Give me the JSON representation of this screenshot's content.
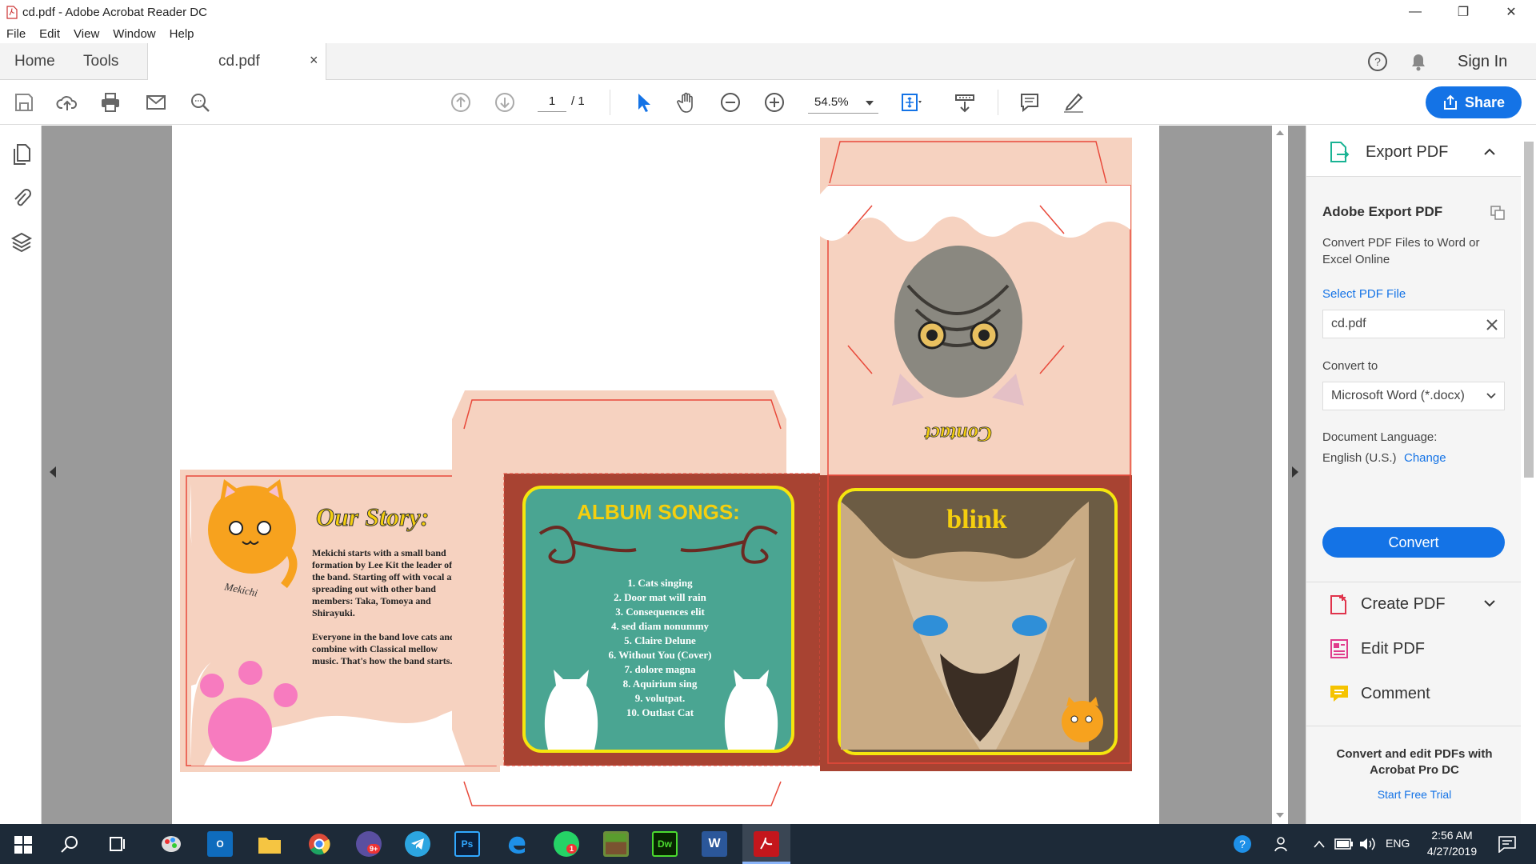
{
  "window": {
    "title": "cd.pdf - Adobe Acrobat Reader DC",
    "minimize_glyph": "—",
    "maximize_glyph": "❐",
    "close_glyph": "✕"
  },
  "menu": [
    "File",
    "Edit",
    "View",
    "Window",
    "Help"
  ],
  "tabs": {
    "home": "Home",
    "tools": "Tools",
    "document": "cd.pdf",
    "close_glyph": "×",
    "sign_in": "Sign In"
  },
  "toolbar": {
    "page_current": "1",
    "page_total": "/ 1",
    "zoom": "54.5%",
    "share": "Share"
  },
  "document": {
    "our_story_title": "Our Story:",
    "story_p1": "Mekichi starts with a small band formation by Lee Kit the leader of the band. Starting off with vocal and spreading out with other band members: Taka, Tomoya and Shirayuki.",
    "story_p2": "Everyone in the band love cats and combine with Classical mellow music. That's how the band starts.",
    "signature": "Mekichi",
    "album_songs_title": "ALBUM SONGS:",
    "songs": [
      "1. Cats singing",
      "2. Door mat will rain",
      "3. Consequences elit",
      "4.      sed diam nonummy",
      "5. Claire Delune",
      "6. Without You (Cover)",
      "7. dolore magna",
      "8. Aquirium sing",
      "9. volutpat.",
      "10. Outlast Cat"
    ],
    "cover_title": "blink",
    "flap_text": "Contact"
  },
  "right_panel": {
    "export_title": "Export PDF",
    "adobe_export": "Adobe Export PDF",
    "description": "Convert PDF Files to Word or Excel Online",
    "select_file": "Select PDF File",
    "file_name": "cd.pdf",
    "convert_to_label": "Convert to",
    "convert_to_value": "Microsoft Word (*.docx)",
    "doc_lang_label": "Document Language:",
    "doc_lang_value": "English (U.S.)",
    "change": "Change",
    "convert_button": "Convert",
    "tools": [
      "Create PDF",
      "Edit PDF",
      "Comment"
    ],
    "promo": "Convert and edit PDFs with Acrobat Pro DC",
    "trial": "Start Free Trial"
  },
  "taskbar": {
    "time": "2:56 AM",
    "date": "4/27/2019",
    "lang": "ENG",
    "badge_mail": "9+",
    "badge_whatsapp": "1",
    "ps_label": "Ps",
    "dw_label": "Dw",
    "word_label": "W"
  },
  "colors": {
    "accent": "#1473e6",
    "taskbar": "#1d2a38",
    "peach": "#f6d2c0",
    "cutline": "#e8493a",
    "teal": "#4aa592",
    "maroon": "#a84332"
  }
}
